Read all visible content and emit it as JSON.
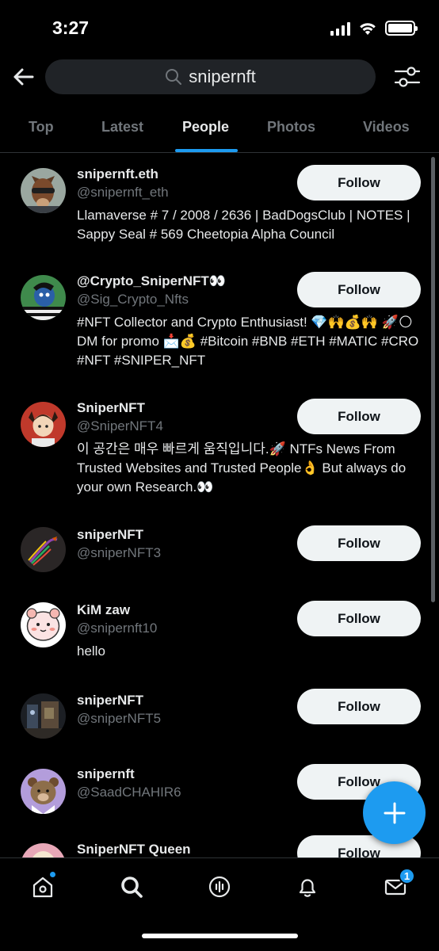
{
  "status_bar": {
    "time": "3:27"
  },
  "search": {
    "query": "snipernft"
  },
  "tabs": [
    {
      "label": "Top"
    },
    {
      "label": "Latest"
    },
    {
      "label": "People"
    },
    {
      "label": "Photos"
    },
    {
      "label": "Videos"
    }
  ],
  "active_tab": "People",
  "users": [
    {
      "name": "snipernft.eth",
      "handle": "@snipernft_eth",
      "bio": "Llamaverse # 7 / 2008 / 2636 | BadDogsClub | NOTES | Sappy Seal # 569 Cheetopia Alpha Council",
      "follow_label": "Follow"
    },
    {
      "name": "@Crypto_SniperNFT👀",
      "handle": "@Sig_Crypto_Nfts",
      "bio": "#NFT Collector and Crypto Enthusiast! 💎🙌💰🙌 🚀🌕 DM for promo 📩💰 #Bitcoin #BNB #ETH #MATIC #CRO #NFT #SNIPER_NFT",
      "follow_label": "Follow"
    },
    {
      "name": "SniperNFT",
      "handle": "@SniperNFT4",
      "bio": "이 공간은 매우 빠르게 움직입니다.🚀 NTFs News From Trusted Websites and Trusted People👌 But always do your own Research.👀",
      "follow_label": "Follow"
    },
    {
      "name": "sniperNFT",
      "handle": "@sniperNFT3",
      "bio": "",
      "follow_label": "Follow"
    },
    {
      "name": "KiM zaw",
      "handle": "@snipernft10",
      "bio": "hello",
      "follow_label": "Follow"
    },
    {
      "name": "sniperNFT",
      "handle": "@sniperNFT5",
      "bio": "",
      "follow_label": "Follow"
    },
    {
      "name": "snipernft",
      "handle": "@SaadCHAHIR6",
      "bio": "",
      "follow_label": "Follow"
    },
    {
      "name": "SniperNFT Queen",
      "handle": "",
      "bio": "",
      "follow_label": "Follow"
    }
  ],
  "bottom_nav": {
    "items": [
      {
        "icon": "home-icon"
      },
      {
        "icon": "search-icon"
      },
      {
        "icon": "spaces-icon"
      },
      {
        "icon": "bell-icon"
      },
      {
        "icon": "mail-icon"
      }
    ],
    "messages_badge": "1"
  },
  "colors": {
    "background": "#000000",
    "accent": "#1d9bf0",
    "secondary_text": "#71767b",
    "follow_button_bg": "#eff3f4"
  }
}
